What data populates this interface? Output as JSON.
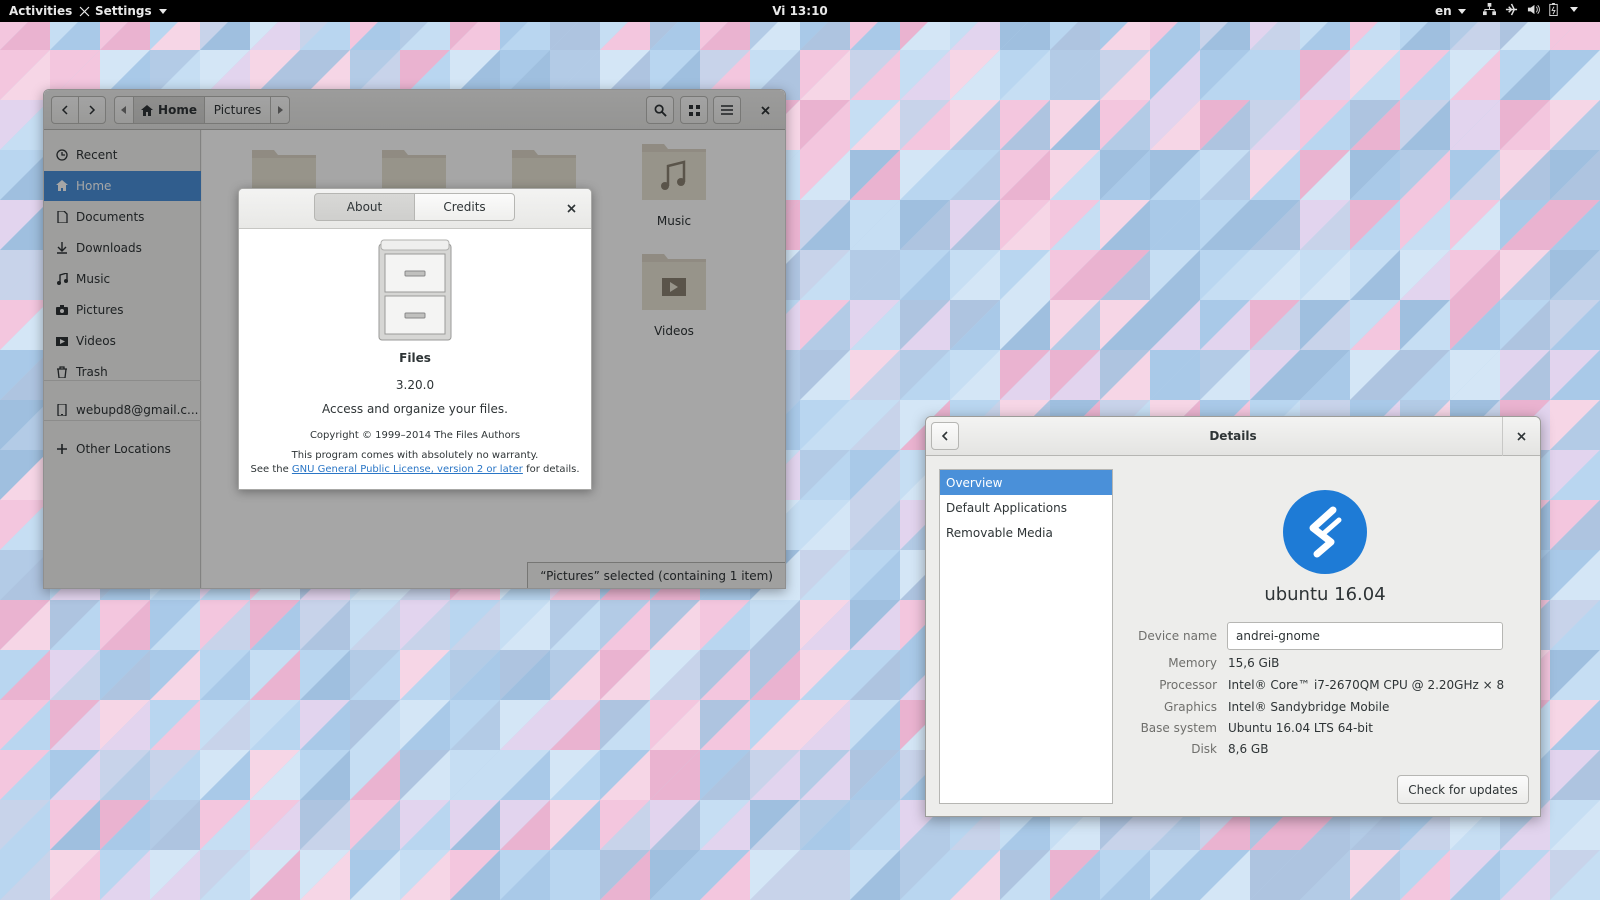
{
  "topbar": {
    "activities": "Activities",
    "app_menu": "Settings",
    "clock": "Vi 13:10",
    "language": "en",
    "tray_icons": [
      "network-icon",
      "airplane-mode-icon",
      "volume-icon",
      "battery-icon"
    ]
  },
  "files": {
    "breadcrumb": {
      "home": "Home",
      "current": "Pictures"
    },
    "sidebar": [
      {
        "icon": "clock-icon",
        "label": "Recent"
      },
      {
        "icon": "home-icon",
        "label": "Home"
      },
      {
        "icon": "document-icon",
        "label": "Documents"
      },
      {
        "icon": "download-icon",
        "label": "Downloads"
      },
      {
        "icon": "music-icon",
        "label": "Music"
      },
      {
        "icon": "camera-icon",
        "label": "Pictures"
      },
      {
        "icon": "video-icon",
        "label": "Videos"
      },
      {
        "icon": "trash-icon",
        "label": "Trash"
      },
      {
        "icon": "phone-icon",
        "label": "webupd8@gmail.c..."
      },
      {
        "icon": "plus-icon",
        "label": "Other Locations"
      }
    ],
    "folders": [
      "Music",
      "Videos"
    ],
    "status": "“Pictures” selected  (containing 1 item)"
  },
  "about": {
    "tabs": [
      "About",
      "Credits"
    ],
    "name": "Files",
    "version": "3.20.0",
    "description": "Access and organize your files.",
    "copyright": "Copyright © 1999–2014 The Files Authors",
    "warranty": "This program comes with absolutely no warranty.",
    "license_prefix": "See the ",
    "license_link": "GNU General Public License, version 2 or later",
    "license_suffix": " for details."
  },
  "details": {
    "title": "Details",
    "nav": [
      "Overview",
      "Default Applications",
      "Removable Media"
    ],
    "os_name": "ubuntu 16.04",
    "device_name_label": "Device name",
    "device_name": "andrei-gnome",
    "rows": [
      {
        "label": "Memory",
        "value": "15,6 GiB"
      },
      {
        "label": "Processor",
        "value": "Intel® Core™ i7-2670QM CPU @ 2.20GHz × 8"
      },
      {
        "label": "Graphics",
        "value": "Intel® Sandybridge Mobile"
      },
      {
        "label": "Base system",
        "value": "Ubuntu 16.04 LTS 64-bit"
      },
      {
        "label": "Disk",
        "value": "8,6 GB"
      }
    ],
    "check_updates": "Check for updates"
  },
  "colors": {
    "accent": "#4a90d9",
    "topbar": "#000000",
    "logo": "#1e7bd6"
  }
}
